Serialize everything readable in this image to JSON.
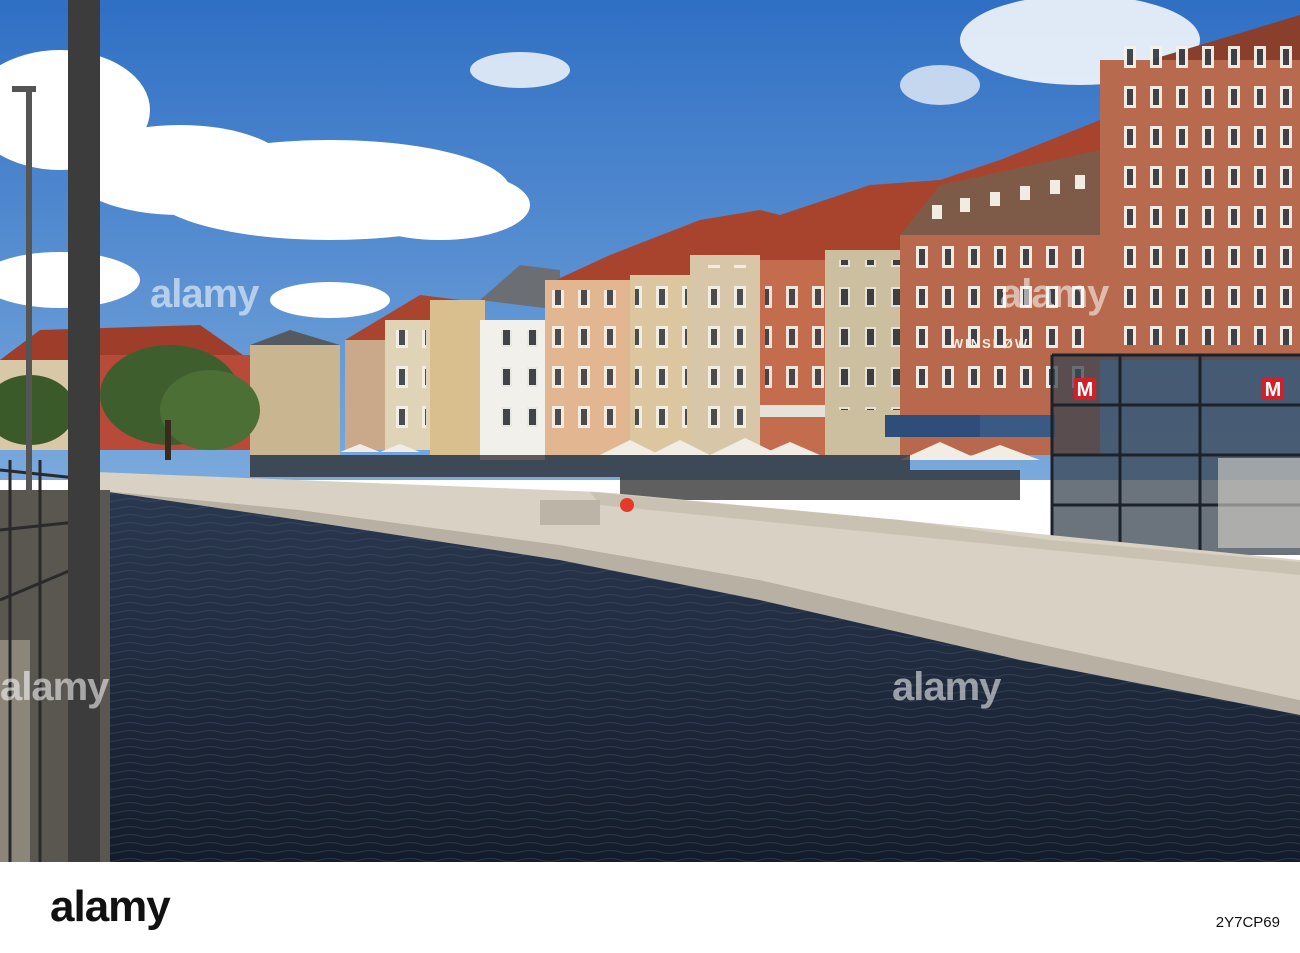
{
  "photo": {
    "building_sign": "WINSLØW",
    "metro_sign": "M",
    "watermarks": [
      "alamy",
      "alamy",
      "alamy",
      "alamy"
    ]
  },
  "footer": {
    "logo": "alamy",
    "image_id": "2Y7CP69"
  },
  "colors": {
    "sky": "#4a86d0",
    "water": "#1e2a3a",
    "brick": "#b86a4e",
    "roof": "#a8442e",
    "metro_red": "#d0202a"
  }
}
